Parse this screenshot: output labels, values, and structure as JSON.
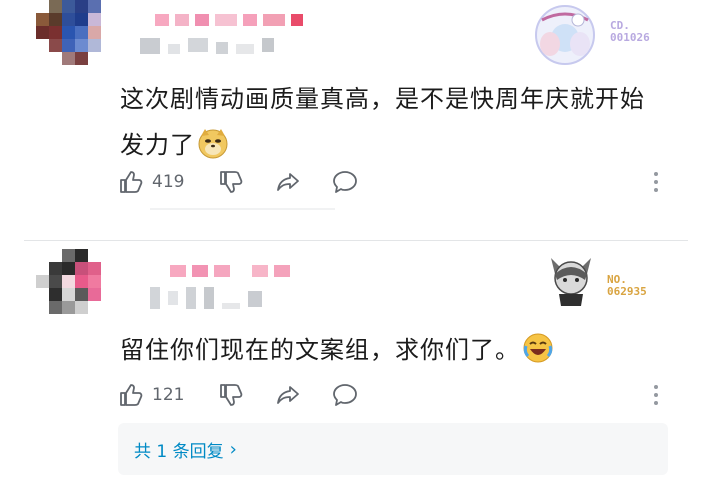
{
  "comments": [
    {
      "id": 1,
      "text": "这次剧情动画质量真高，是不是快周年庆就开始发力了",
      "emoji": "doge-emoji",
      "likes": "419",
      "decoration_no_label": "CD.",
      "decoration_no": "001026"
    },
    {
      "id": 2,
      "text": "留住你们现在的文案组，求你们了。",
      "emoji": "crying-laugh-emoji",
      "likes": "121",
      "decoration_no_label": "NO.",
      "decoration_no": "062935",
      "reply_summary": "共 1 条回复"
    }
  ],
  "icons": {
    "like": "thumbs-up-icon",
    "dislike": "thumbs-down-icon",
    "share": "share-icon",
    "reply": "reply-bubble-icon",
    "more": "more-vertical-icon",
    "reply_chevron": "chevron-right-icon"
  },
  "colors": {
    "text": "#18191c",
    "muted": "#61666d",
    "link": "#008ac5",
    "badge1_number": "#b8a9e0",
    "badge2_number": "#d9a441",
    "username_pink": "#f5a3bd"
  }
}
